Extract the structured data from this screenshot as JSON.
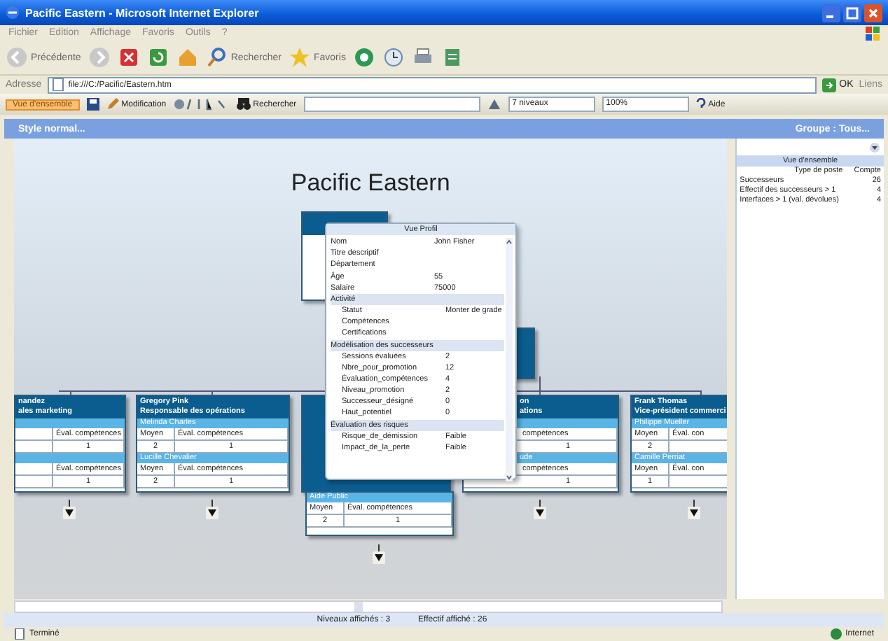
{
  "window": {
    "title": "Pacific Eastern - Microsoft Internet Explorer"
  },
  "menu": [
    "Fichier",
    "Edition",
    "Affichage",
    "Favoris",
    "Outils",
    "?"
  ],
  "toolbar": [
    {
      "kind": "back",
      "label": "Précédente"
    },
    {
      "kind": "forward"
    },
    {
      "kind": "stop"
    },
    {
      "kind": "refresh"
    },
    {
      "kind": "home"
    },
    {
      "kind": "search",
      "label": "Rechercher"
    },
    {
      "kind": "favorites",
      "label": "Favoris"
    },
    {
      "kind": "media"
    },
    {
      "kind": "history"
    },
    {
      "kind": "print"
    },
    {
      "kind": "edit"
    }
  ],
  "address": {
    "label": "Adresse",
    "value": "file:///C:/Pacific/Eastern.htm",
    "go": "OK",
    "links": "Liens"
  },
  "app_toolbar": {
    "view": "Vue d'ensemble",
    "edit": "Modification",
    "search": "Rechercher",
    "levels": "7 niveaux",
    "zoom": "100%",
    "help": "Aide"
  },
  "header": {
    "left": "Style normal...",
    "right": "Groupe : Tous..."
  },
  "chart": {
    "title": "Pacific Eastern",
    "nodes": [
      {
        "kind": "top"
      },
      {
        "kind": "block"
      },
      {
        "kind": "full",
        "name": "nandez",
        "role": "ales marketing",
        "groups": [
          {
            "col_2": "Éval. compétences",
            "value_2": "1"
          },
          {
            "col_2": "Éval. compétences",
            "value_2": "1"
          }
        ]
      },
      {
        "kind": "full",
        "name": "Gregory Pink",
        "role": "Responsable des opérations",
        "groups": [
          {
            "label": "Melinda Charles",
            "col_1": "Moyen",
            "col_2": "Éval. compétences",
            "value_1": "2",
            "value_2": "1"
          },
          {
            "label": "Lucille Chevalier",
            "col_1": "Moyen",
            "col_2": "Éval. compétences",
            "value_1": "2",
            "value_2": "1"
          }
        ]
      },
      {
        "kind": "hidden"
      },
      {
        "kind": "partial",
        "name": "on",
        "role": "ations",
        "groups": [
          {
            "col_2": "compétences",
            "value_2": "1"
          },
          {
            "label": "ude",
            "col_2": "compétences",
            "value_2": "1"
          }
        ]
      },
      {
        "kind": "full",
        "name": "Frank Thomas",
        "role": "Vice-président commerci",
        "groups": [
          {
            "label": "Philippe Mueller",
            "col_1": "Moyen",
            "col_2": "Éval. con",
            "value_1": "2"
          },
          {
            "label": "Camille Perriat",
            "col_1": "Moyen",
            "col_2": "Éval. con",
            "value_1": "1"
          }
        ]
      },
      {
        "kind": "card",
        "name": "Aide Public",
        "groups": [
          {
            "col_1": "Moyen",
            "col_2": "Éval. compétences",
            "value_1": "2",
            "value_2": "1"
          }
        ]
      }
    ]
  },
  "tooltip": {
    "title": "Vue Profil",
    "rows": [
      {
        "kind": "field",
        "label": "Nom",
        "value": "John Fisher"
      },
      {
        "kind": "field",
        "label": "Titre descriptif"
      },
      {
        "kind": "field",
        "label": "Département"
      },
      {
        "kind": "field",
        "label": "Âge",
        "value": "55"
      },
      {
        "kind": "field",
        "label": "Salaire",
        "value": "75000"
      },
      {
        "kind": "section",
        "label": "Activité"
      },
      {
        "kind": "sub",
        "label": "Statut",
        "value": "Monter de grade"
      },
      {
        "kind": "sub",
        "label": "Compétences"
      },
      {
        "kind": "sub",
        "label": "Certifications"
      },
      {
        "kind": "section",
        "label": "Modélisation des successeurs"
      },
      {
        "kind": "sub",
        "label": "Sessions évaluées",
        "value": "2"
      },
      {
        "kind": "sub",
        "label": "Nbre_pour_promotion",
        "value": "12"
      },
      {
        "kind": "sub",
        "label": "Évaluation_compétences",
        "value": "4"
      },
      {
        "kind": "sub",
        "label": "Niveau_promotion",
        "value": "2"
      },
      {
        "kind": "sub",
        "label": "Successeur_désigné",
        "value": "0"
      },
      {
        "kind": "sub",
        "label": "Haut_potentiel",
        "value": "0"
      },
      {
        "kind": "section",
        "label": "Évaluation des risques"
      },
      {
        "kind": "sub",
        "label": "Risque_de_démission",
        "value": "Faible"
      },
      {
        "kind": "sub",
        "label": "Impact_de_la_perte",
        "value": "Faible"
      }
    ]
  },
  "side_panel": {
    "title": "Vue d'ensemble",
    "columns": [
      "Type de poste",
      "Compte"
    ],
    "rows": [
      [
        "Successeurs",
        "26"
      ],
      [
        "Effectif des successeurs > 1",
        "4"
      ],
      [
        "Interfaces > 1 (val. dévolues)",
        "4"
      ]
    ]
  },
  "footer": {
    "levels": "Niveaux affichés : 3",
    "count": "Effectif affiché : 26"
  },
  "status": {
    "left": "Terminé",
    "right": "Internet"
  }
}
